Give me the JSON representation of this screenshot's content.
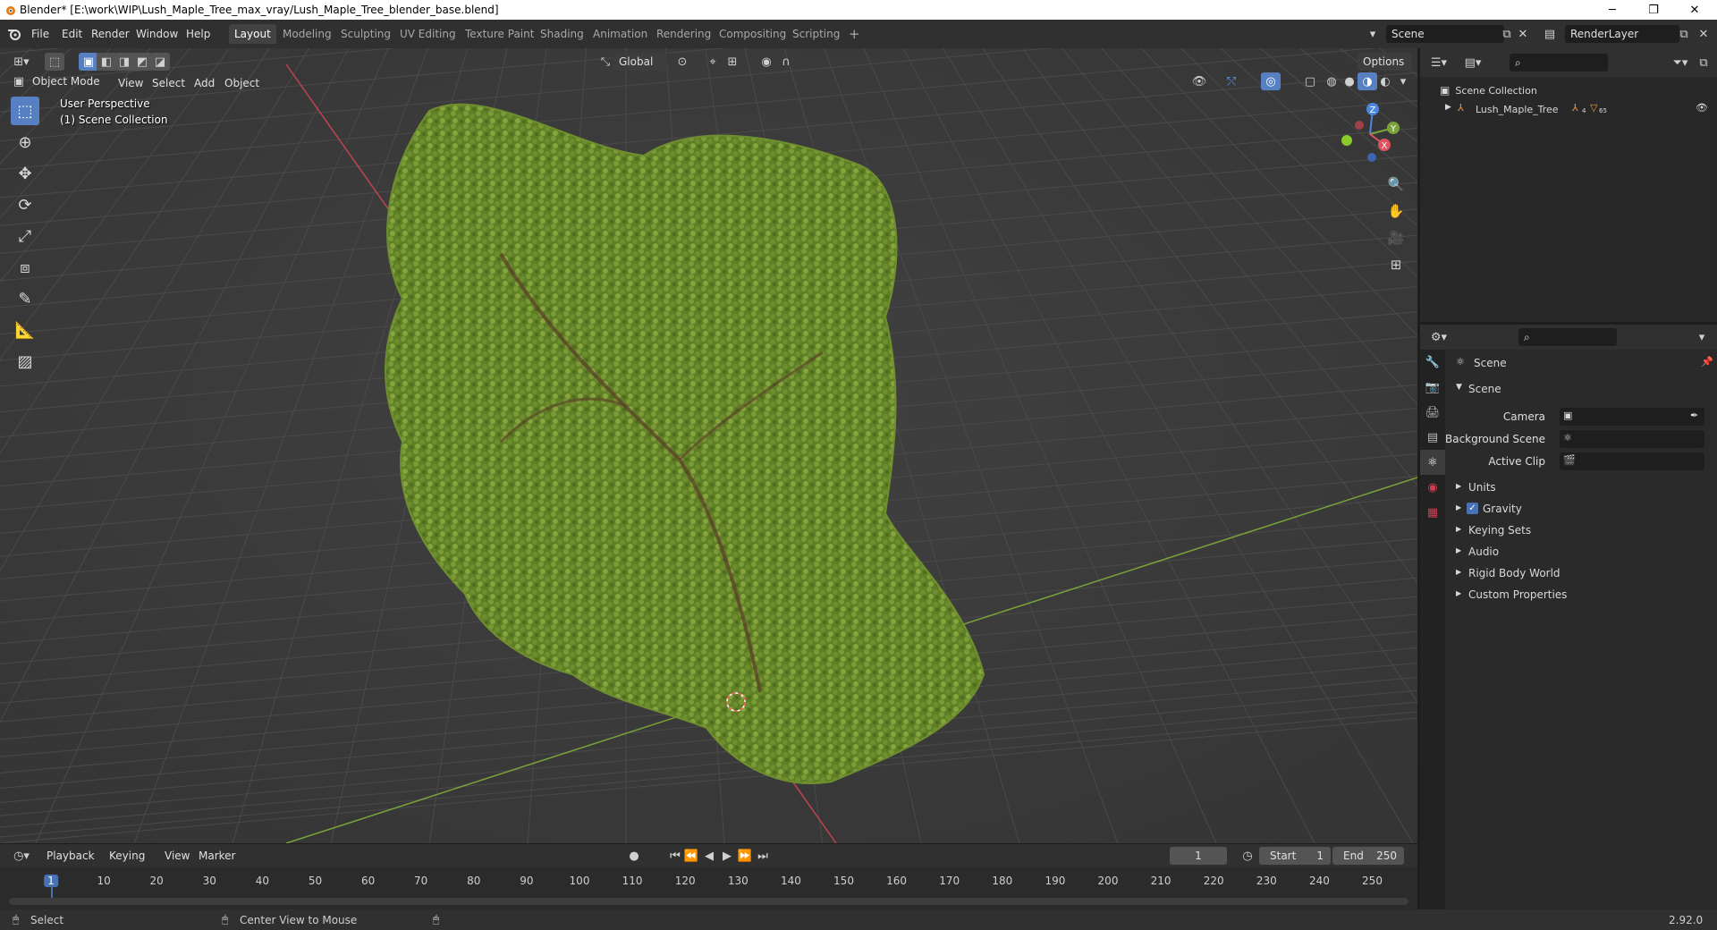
{
  "window": {
    "title": "Blender* [E:\\work\\WIP\\Lush_Maple_Tree_max_vray/Lush_Maple_Tree_blender_base.blend]",
    "minimize": "─",
    "maximize": "❐",
    "close": "✕"
  },
  "menu": {
    "items": [
      "File",
      "Edit",
      "Render",
      "Window",
      "Help"
    ]
  },
  "workspaces": {
    "tabs": [
      "Layout",
      "Modeling",
      "Sculpting",
      "UV Editing",
      "Texture Paint",
      "Shading",
      "Animation",
      "Rendering",
      "Compositing",
      "Scripting"
    ],
    "active": "Layout",
    "add": "+"
  },
  "scene_selector": {
    "value": "Scene"
  },
  "view_layer_selector": {
    "value": "RenderLayer"
  },
  "viewport": {
    "mode": "Object Mode",
    "menus": [
      "View",
      "Select",
      "Add",
      "Object"
    ],
    "orientation": "Global",
    "options": "Options",
    "overlay_line1": "User Perspective",
    "overlay_line2": "(1) Scene Collection",
    "gizmo": {
      "z": "Z",
      "y": "Y",
      "x": "X"
    }
  },
  "outliner": {
    "root": "Scene Collection",
    "items": [
      {
        "name": "Lush_Maple_Tree",
        "badge1": "4",
        "badge2": "65"
      }
    ]
  },
  "properties": {
    "context": "Scene",
    "section": "Scene",
    "fields": [
      {
        "label": "Camera",
        "value": ""
      },
      {
        "label": "Background Scene",
        "value": ""
      },
      {
        "label": "Active Clip",
        "value": ""
      }
    ],
    "panels": [
      "Units",
      "Gravity",
      "Keying Sets",
      "Audio",
      "Rigid Body World",
      "Custom Properties"
    ],
    "gravity_checked": true
  },
  "timeline": {
    "menus": [
      "Playback",
      "Keying",
      "View",
      "Marker"
    ],
    "current_frame": "1",
    "start_label": "Start",
    "start": "1",
    "end_label": "End",
    "end": "250",
    "ruler": [
      "1",
      "10",
      "20",
      "30",
      "40",
      "50",
      "60",
      "70",
      "80",
      "90",
      "100",
      "110",
      "120",
      "130",
      "140",
      "150",
      "160",
      "170",
      "180",
      "190",
      "200",
      "210",
      "220",
      "230",
      "240",
      "250"
    ]
  },
  "statusbar": {
    "left": "Select",
    "middle": "Center View to Mouse",
    "version": "2.92.0"
  },
  "colors": {
    "accent": "#5680c2",
    "axis_x": "#c0444e",
    "axis_y": "#7aa23a",
    "foliage": "#6b8a2c"
  }
}
